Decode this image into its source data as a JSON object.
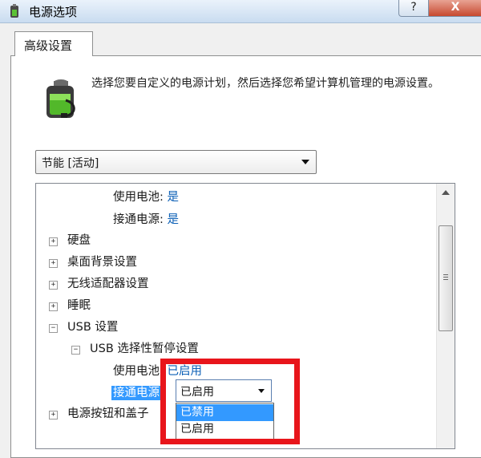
{
  "window": {
    "title": "电源选项",
    "help_label": "?",
    "close_label": "X"
  },
  "tab": {
    "label": "高级设置"
  },
  "description": "选择您要自定义的电源计划，然后选择您希望计算机管理的电源设置。",
  "plan_select": {
    "value": "节能 [活动]"
  },
  "tree": {
    "rows": [
      {
        "label": "使用电池:",
        "value": "是"
      },
      {
        "label": "接通电源:",
        "value": "是"
      },
      {
        "label": "硬盘"
      },
      {
        "label": "桌面背景设置"
      },
      {
        "label": "无线适配器设置"
      },
      {
        "label": "睡眠"
      },
      {
        "label": "USB 设置"
      },
      {
        "label": "USB 选择性暂停设置"
      },
      {
        "label": "使用电池:",
        "value": "已启用"
      },
      {
        "label": "接通电源:"
      },
      {
        "label": "电源按钮和盖子"
      }
    ]
  },
  "dropdown": {
    "value": "已启用",
    "options": [
      "已禁用",
      "已启用"
    ]
  },
  "colors": {
    "annotation_red": "#e8151b",
    "link_blue": "#0b5fb6",
    "selection_blue": "#3399ff"
  }
}
